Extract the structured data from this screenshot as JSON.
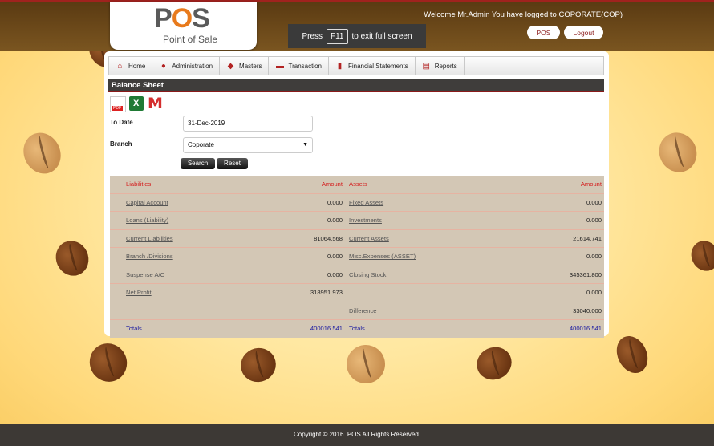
{
  "header": {
    "logo_word": "POS",
    "logo_sub": "Point of Sale",
    "welcome_text": "Welcome Mr.Admin You have logged to COPORATE(COP)",
    "fullscreen_pre": "Press",
    "fullscreen_key": "F11",
    "fullscreen_post": "to exit full screen",
    "pos_label": "POS",
    "logout_label": "Logout"
  },
  "nav": {
    "items": [
      {
        "label": "Home",
        "icon": "home-icon"
      },
      {
        "label": "Administration",
        "icon": "users-icon"
      },
      {
        "label": "Masters",
        "icon": "shield-icon"
      },
      {
        "label": "Transaction",
        "icon": "car-icon"
      },
      {
        "label": "Financial Statements",
        "icon": "document-icon"
      },
      {
        "label": "Reports",
        "icon": "report-icon"
      }
    ]
  },
  "page": {
    "title": "Balance Sheet",
    "export_icons": [
      "pdf-icon",
      "excel-icon",
      "gmail-icon"
    ]
  },
  "form": {
    "to_date_label": "To Date",
    "to_date_value": "31-Dec-2019",
    "branch_label": "Branch",
    "branch_value": "Coporate",
    "search_label": "Search",
    "reset_label": "Reset"
  },
  "report": {
    "head": {
      "liabilities": "Liabilities",
      "amount1": "Amount",
      "assets": "Assets",
      "amount2": "Amount"
    },
    "rows": [
      {
        "liab": "Capital Account",
        "liab_amt": "0.000",
        "asset": "Fixed Assets",
        "asset_amt": "0.000"
      },
      {
        "liab": "Loans (Liability)",
        "liab_amt": "0.000",
        "asset": "Investments",
        "asset_amt": "0.000"
      },
      {
        "liab": "Current Liabilities",
        "liab_amt": "81064.568",
        "asset": "Current Assets",
        "asset_amt": "21614.741"
      },
      {
        "liab": "Branch /Divisions",
        "liab_amt": "0.000",
        "asset": "Misc.Expenses (ASSET)",
        "asset_amt": "0.000"
      },
      {
        "liab": "Suspense A/C",
        "liab_amt": "0.000",
        "asset": "Closing Stock",
        "asset_amt": "345361.800"
      },
      {
        "liab": "Net Profit",
        "liab_amt": "318951.973",
        "asset": "",
        "asset_amt": "0.000"
      },
      {
        "liab": "",
        "liab_amt": "",
        "asset": "Difference",
        "asset_amt": "33040.000"
      }
    ],
    "totals": {
      "label1": "Totals",
      "amt1": "400016.541",
      "label2": "Totals",
      "amt2": "400016.541"
    }
  },
  "footer": {
    "text": "Copyright © 2016. POS All Rights Reserved."
  },
  "colors": {
    "header_bg": "#6b4a18",
    "accent": "#a0221e",
    "report_bg": "#d3c7b5",
    "totals": "#1a1aa0"
  }
}
